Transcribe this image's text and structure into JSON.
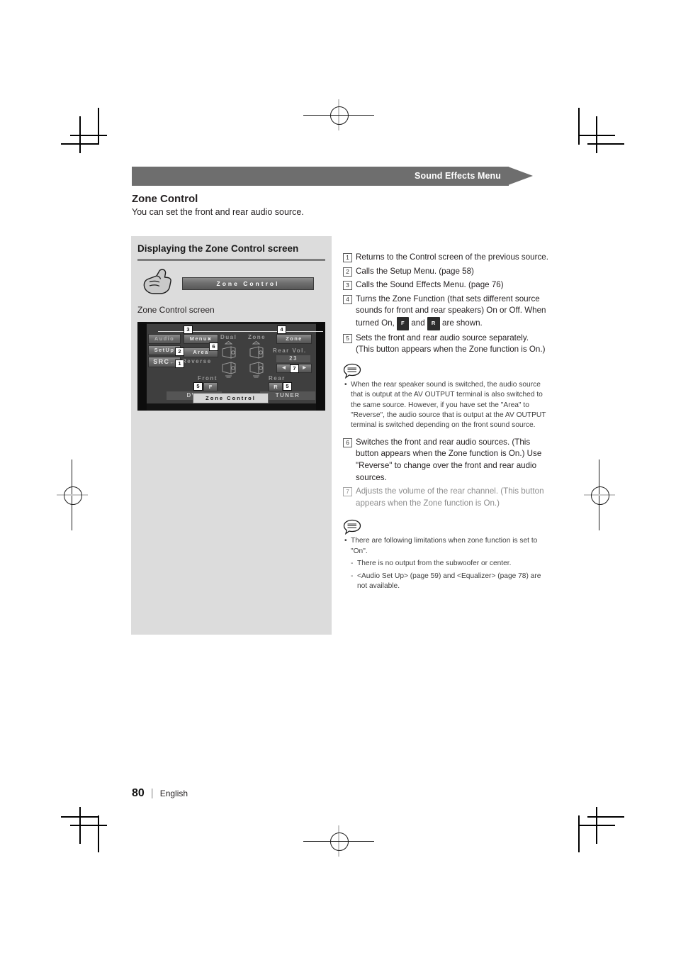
{
  "header": {
    "banner_title": "Sound Effects Menu"
  },
  "section": {
    "title": "Zone Control",
    "subtitle": "You can set the front and rear audio source."
  },
  "panel": {
    "heading": "Displaying the Zone Control screen",
    "hand_icon": "pointing-hand-icon",
    "zone_control_button_label": "Zone Control",
    "screen_caption": "Zone Control screen"
  },
  "device_screen": {
    "source_button": "Audio",
    "setup_button": "SetUp",
    "src_button": "SRC",
    "menu_button": "Menu",
    "area_button": "Area",
    "reverse_label": "Reverse",
    "dual_label": "Dual",
    "zone_label": "Zone",
    "zone_toggle": "Zone",
    "rear_vol_label": "Rear Vol.",
    "rear_vol_value": "23",
    "left_arrow": "◀",
    "right_arrow": "▶",
    "front_label": "Front",
    "front_badge": "F",
    "front_source": "DVD",
    "rear_label": "Rear",
    "rear_badge": "R",
    "rear_source": "TUNER",
    "bottom_tab": "Zone Control",
    "callouts": [
      "1",
      "2",
      "3",
      "4",
      "5",
      "5",
      "6",
      "7"
    ]
  },
  "items": [
    {
      "num": "1",
      "text": "Returns to the Control screen of the previous source.",
      "muted": false
    },
    {
      "num": "2",
      "text": "Calls the Setup Menu. (page 58)",
      "muted": false
    },
    {
      "num": "3",
      "text": "Calls the Sound Effects Menu. (page 76)",
      "muted": false
    },
    {
      "num": "4",
      "text_before": "Turns the Zone Function (that sets different source sounds for front and rear speakers) On or Off. When turned On, ",
      "badge_f": "F",
      "text_mid": " and ",
      "badge_r": "R",
      "text_after": " are shown.",
      "muted": false
    },
    {
      "num": "5",
      "text": "Sets the front and rear audio source separately. (This button appears when the Zone function is On.)",
      "muted": false
    },
    {
      "num": "6",
      "text": "Switches the front and rear audio sources. (This button appears when the Zone function is On.) Use \"Reverse\" to change over the front and rear audio sources.",
      "muted": false
    },
    {
      "num": "7",
      "text": "Adjusts the volume of the rear channel. (This button appears when the Zone function is On.)",
      "muted": true
    }
  ],
  "note1": {
    "icon": "note-bubble-icon",
    "bullet": "•",
    "text": "When the rear speaker sound is switched, the audio source that is output at the AV OUTPUT terminal is also switched to the same source. However, if you have set the \"Area\" to \"Reverse\", the audio source that is output at the AV OUTPUT terminal is switched depending on the front sound source."
  },
  "note2": {
    "icon": "note-bubble-icon",
    "bullet": "•",
    "text": "There are following limitations when zone function is set to \"On\".",
    "sub_items": [
      {
        "dash": "-",
        "text": "There is no output from the subwoofer or center."
      },
      {
        "dash": "-",
        "text": "<Audio Set Up> (page 59) and <Equalizer> (page 78) are not available."
      }
    ]
  },
  "footer": {
    "page_number": "80",
    "separator": "|",
    "language": "English"
  }
}
